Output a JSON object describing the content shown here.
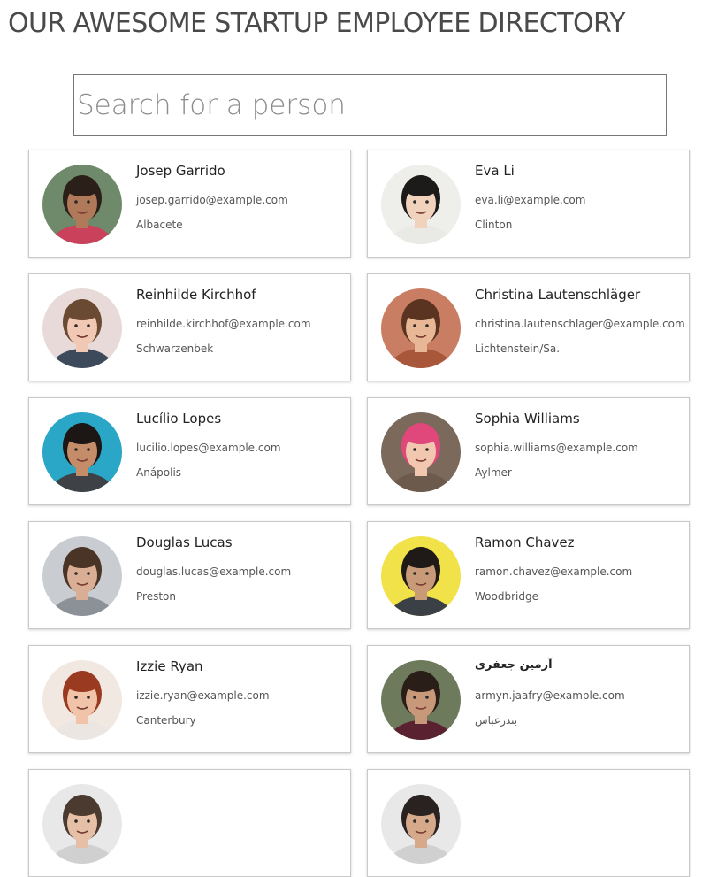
{
  "header": {
    "title": "OUR AWESOME STARTUP EMPLOYEE DIRECTORY"
  },
  "search": {
    "placeholder": "Search for a person",
    "value": ""
  },
  "employees": [
    {
      "name": "Josep Garrido",
      "email": "josep.garrido@example.com",
      "city": "Albacete",
      "avatar": {
        "bg": "#6f8a6a",
        "skin": "#b07a5a",
        "hair": "#2b2019",
        "shirt": "#c9415a"
      }
    },
    {
      "name": "Eva Li",
      "email": "eva.li@example.com",
      "city": "Clinton",
      "avatar": {
        "bg": "#eeeeea",
        "skin": "#f0d2bd",
        "hair": "#1d1a1a",
        "shirt": "#e9e9e6"
      }
    },
    {
      "name": "Reinhilde Kirchhof",
      "email": "reinhilde.kirchhof@example.com",
      "city": "Schwarzenbek",
      "avatar": {
        "bg": "#e7dad9",
        "skin": "#f1c8b3",
        "hair": "#6b4a33",
        "shirt": "#3d4a5c"
      }
    },
    {
      "name": "Christina Lautenschläger",
      "email": "christina.lautenschlager@example.com",
      "city": "Lichtenstein/Sa.",
      "avatar": {
        "bg": "#c97d63",
        "skin": "#e7b796",
        "hair": "#5a3421",
        "shirt": "#a9573b"
      }
    },
    {
      "name": "Lucílio Lopes",
      "email": "lucilio.lopes@example.com",
      "city": "Anápolis",
      "avatar": {
        "bg": "#2aa6c7",
        "skin": "#c58c6a",
        "hair": "#1c1714",
        "shirt": "#3e4146"
      }
    },
    {
      "name": "Sophia Williams",
      "email": "sophia.williams@example.com",
      "city": "Aylmer",
      "avatar": {
        "bg": "#7b6a5b",
        "skin": "#f2c7b0",
        "hair": "#e0477a",
        "shirt": "#6c5a4c"
      }
    },
    {
      "name": "Douglas Lucas",
      "email": "douglas.lucas@example.com",
      "city": "Preston",
      "avatar": {
        "bg": "#c9ccd1",
        "skin": "#d9ae94",
        "hair": "#4a3426",
        "shirt": "#8c9097"
      }
    },
    {
      "name": "Ramon Chavez",
      "email": "ramon.chavez@example.com",
      "city": "Woodbridge",
      "avatar": {
        "bg": "#f1e24a",
        "skin": "#c99a78",
        "hair": "#1f1a17",
        "shirt": "#3b3f46"
      }
    },
    {
      "name": "Izzie Ryan",
      "email": "izzie.ryan@example.com",
      "city": "Canterbury",
      "avatar": {
        "bg": "#f2e8e2",
        "skin": "#f1c4a9",
        "hair": "#9a3b21",
        "shirt": "#ece6e2"
      }
    },
    {
      "name": "آرمین جعفری",
      "email": "armyn.jaafry@example.com",
      "city": "بندرعباس",
      "rtl": true,
      "avatar": {
        "bg": "#6e7a5c",
        "skin": "#c8987a",
        "hair": "#2a1e18",
        "shirt": "#5a2230"
      }
    },
    {
      "name": "",
      "email": "",
      "city": "",
      "avatar": {
        "bg": "#e8e8e8",
        "skin": "#e6c0a6",
        "hair": "#4a3a30",
        "shirt": "#d0d0d0"
      }
    },
    {
      "name": "",
      "email": "",
      "city": "",
      "avatar": {
        "bg": "#e8e8e8",
        "skin": "#d5a98a",
        "hair": "#2a2220",
        "shirt": "#d0d0d0"
      }
    }
  ]
}
